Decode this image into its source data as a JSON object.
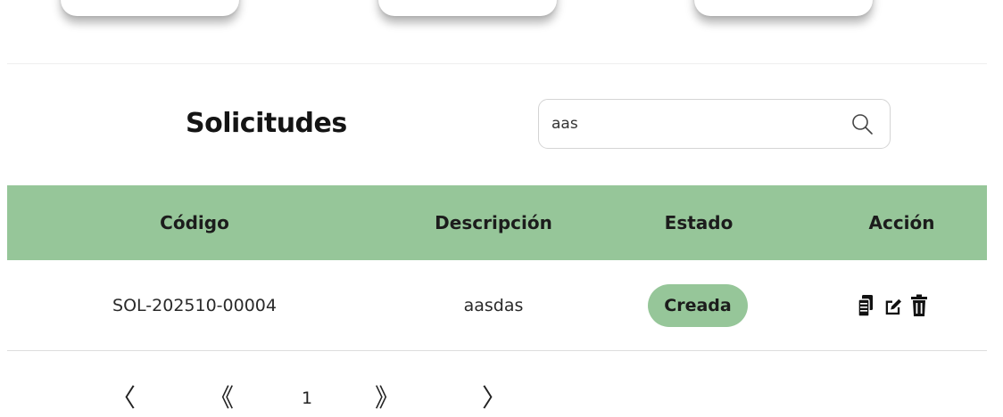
{
  "search": {
    "value": "aas"
  },
  "page": {
    "title": "Solicitudes"
  },
  "table": {
    "headers": [
      "Código",
      "Descripción",
      "Estado",
      "Acción"
    ],
    "rows": [
      {
        "codigo": "SOL-202510-00004",
        "descripcion": "aasdas",
        "estado": "Creada"
      }
    ]
  },
  "pagination": {
    "prev": "〈",
    "first": "《",
    "current": "1",
    "last": "》",
    "next": "〉"
  },
  "icons": {
    "search": "search-icon",
    "copy": "copy-icon",
    "edit": "edit-icon",
    "delete": "trash-icon"
  },
  "colors": {
    "header_bg": "#96c699",
    "badge_bg": "#96c699"
  }
}
